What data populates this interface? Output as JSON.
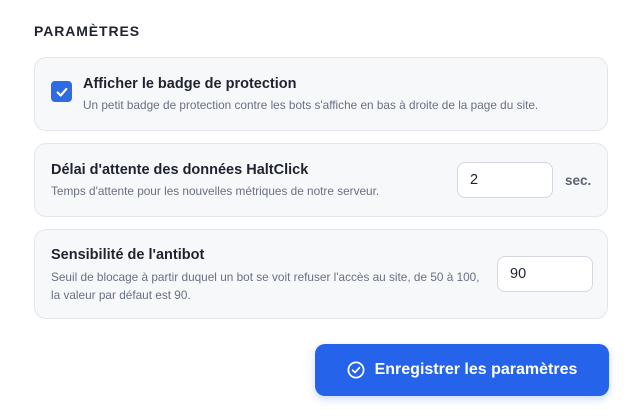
{
  "section": {
    "title": "PARAMÈTRES"
  },
  "settings": {
    "badge": {
      "label": "Afficher le badge de protection",
      "description": "Un petit badge de protection contre les bots s'affiche en bas à droite de la page du site.",
      "checked": true
    },
    "delay": {
      "label": "Délai d'attente des données HaltClick",
      "description": "Temps d'attente pour les nouvelles métriques de notre serveur.",
      "value": "2",
      "unit": "sec."
    },
    "sensitivity": {
      "label": "Sensibilité de l'antibot",
      "description": "Seuil de blocage à partir duquel un bot se voit refuser l'accès au site, de 50 à 100, la valeur par défaut est 90.",
      "value": "90"
    }
  },
  "actions": {
    "save_label": "Enregistrer les paramètres",
    "save_icon": "check-circle-icon"
  },
  "colors": {
    "accent": "#2563eb",
    "checkbox": "#2f6be3"
  }
}
